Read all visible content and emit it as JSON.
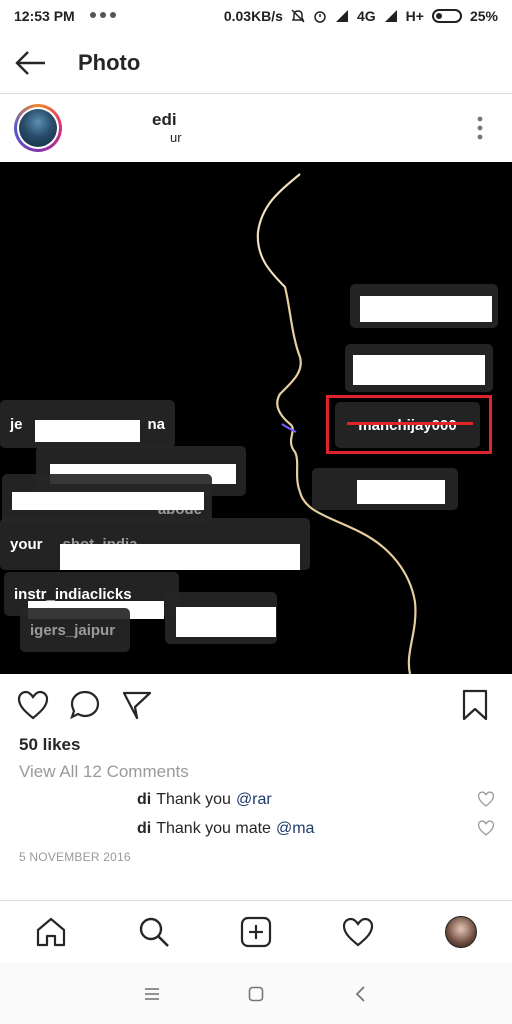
{
  "status_bar": {
    "time": "12:53 PM",
    "speed": "0.03KB/s",
    "network": "4G",
    "network2": "H+",
    "battery": "25%",
    "battery_level": 0.25
  },
  "app_bar": {
    "title": "Photo",
    "back_icon": "arrow-left-icon"
  },
  "post_header": {
    "username": "edi",
    "location": "ur",
    "more_icon": "more-vertical-icon"
  },
  "photo": {
    "tags": [
      {
        "label": "je"
      },
      {
        "label": "na"
      },
      {
        "label": "abode"
      },
      {
        "label": "your"
      },
      {
        "label": "shot_india"
      },
      {
        "label": "instr_indiaclicks"
      },
      {
        "label": "igers_jaipur"
      },
      {
        "label": "manchijay000"
      }
    ]
  },
  "actions": {
    "like_icon": "heart-icon",
    "comment_icon": "comment-icon",
    "share_icon": "send-icon",
    "save_icon": "bookmark-icon"
  },
  "likes": "50 likes",
  "view_comments": "View All 12 Comments",
  "comments": [
    {
      "user": "di",
      "text": "Thank you",
      "mention": "@rar"
    },
    {
      "user": "di",
      "text": "Thank you mate",
      "mention": "@ma"
    }
  ],
  "date": "5 NOVEMBER 2016",
  "bottom_nav": [
    "home-icon",
    "search-icon",
    "add-icon",
    "activity-heart-icon",
    "profile-avatar"
  ],
  "system_nav": [
    "menu-icon",
    "home-square-icon",
    "back-chevron-icon"
  ],
  "colors": {
    "highlight": "#e0242c",
    "mention": "#1e3a6b",
    "muted": "#9a9a9a"
  }
}
